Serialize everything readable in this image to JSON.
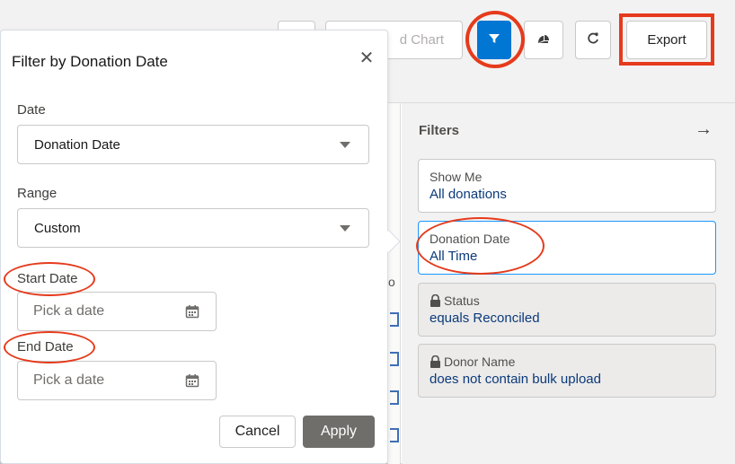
{
  "toolbar": {
    "add_chart_label": "d Chart",
    "export_label": "Export",
    "icons": [
      "filter-icon",
      "chart-toggle-icon",
      "refresh-icon"
    ]
  },
  "filters_panel": {
    "title": "Filters",
    "collapse_icon": "→",
    "cards": [
      {
        "label": "Show Me",
        "value": "All donations",
        "locked": false
      },
      {
        "label": "Donation Date",
        "value": "All Time",
        "locked": false
      },
      {
        "label": "Status",
        "value": "equals Reconciled",
        "locked": true
      },
      {
        "label": "Donor Name",
        "value": "does not contain bulk upload",
        "locked": true
      }
    ]
  },
  "middle_strip": {
    "char": "o"
  },
  "popover": {
    "title": "Filter by Donation Date",
    "close_glyph": "✕",
    "date": {
      "label": "Date",
      "value": "Donation Date"
    },
    "range": {
      "label": "Range",
      "value": "Custom"
    },
    "start_date": {
      "label": "Start Date",
      "placeholder": "Pick a date"
    },
    "end_date": {
      "label": "End Date",
      "placeholder": "Pick a date"
    },
    "cancel_label": "Cancel",
    "apply_label": "Apply"
  },
  "colors": {
    "accent": "#0176d3",
    "annotation": "#e53b1c",
    "value_text": "#0b3a7a",
    "disabled_button": "#706e6b"
  }
}
